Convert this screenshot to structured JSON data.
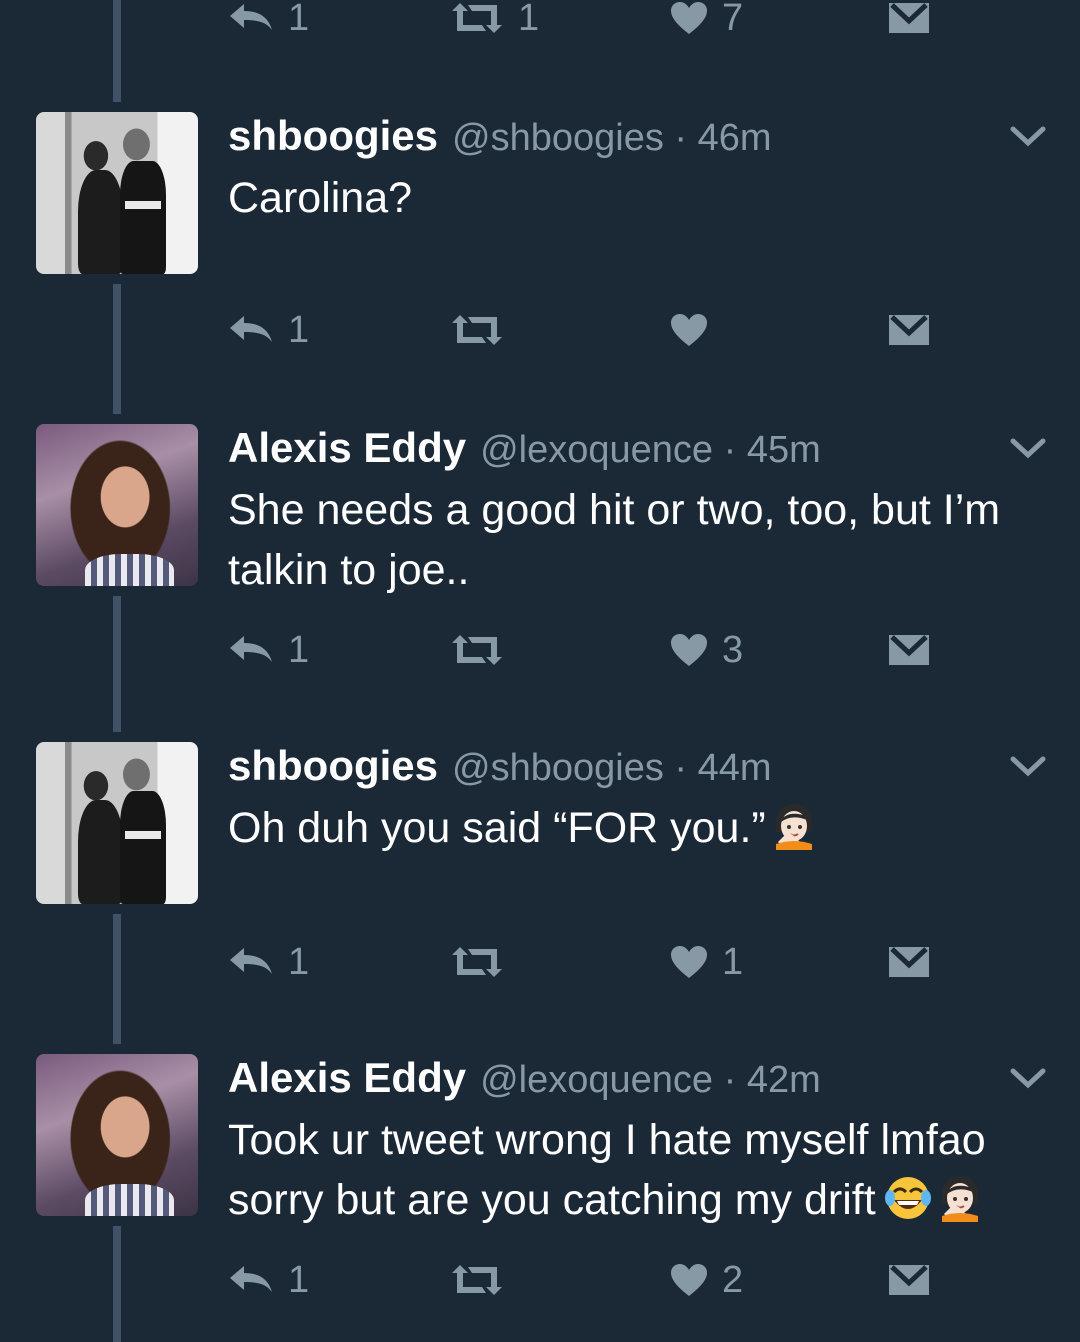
{
  "top_actions": {
    "reply_count": "1",
    "retweet_count": "1",
    "like_count": "7"
  },
  "tweets": [
    {
      "name": "shboogies",
      "handle": "@shboogies",
      "time": "46m",
      "text_lines": [
        "Carolina?"
      ],
      "emojis": [],
      "avatar": "couple-photo-bw",
      "actions": {
        "reply_count": "1",
        "retweet_count": "",
        "like_count": ""
      }
    },
    {
      "name": "Alexis Eddy",
      "handle": "@lexoquence",
      "time": "45m",
      "text_lines": [
        "She needs a good hit or two, too, but I’m",
        "talkin to joe.."
      ],
      "emojis": [],
      "avatar": "woman-selfie",
      "actions": {
        "reply_count": "1",
        "retweet_count": "",
        "like_count": "3"
      }
    },
    {
      "name": "shboogies",
      "handle": "@shboogies",
      "time": "44m",
      "text_lines": [
        "Oh duh you said “FOR you.”"
      ],
      "emojis": [
        "face-palm-emoji"
      ],
      "avatar": "couple-photo-bw",
      "actions": {
        "reply_count": "1",
        "retweet_count": "",
        "like_count": "1"
      }
    },
    {
      "name": "Alexis Eddy",
      "handle": "@lexoquence",
      "time": "42m",
      "text_lines": [
        "Took ur tweet wrong I hate myself lmfao",
        "sorry but are you catching my drift"
      ],
      "emojis": [
        "tears-of-joy-emoji",
        "face-palm-emoji"
      ],
      "avatar": "woman-selfie",
      "actions": {
        "reply_count": "1",
        "retweet_count": "",
        "like_count": "2"
      }
    }
  ],
  "separator": "·",
  "colors": {
    "background": "#1b2836",
    "muted": "#8899a6",
    "thread_line": "#3f5267",
    "text": "#ffffff"
  }
}
